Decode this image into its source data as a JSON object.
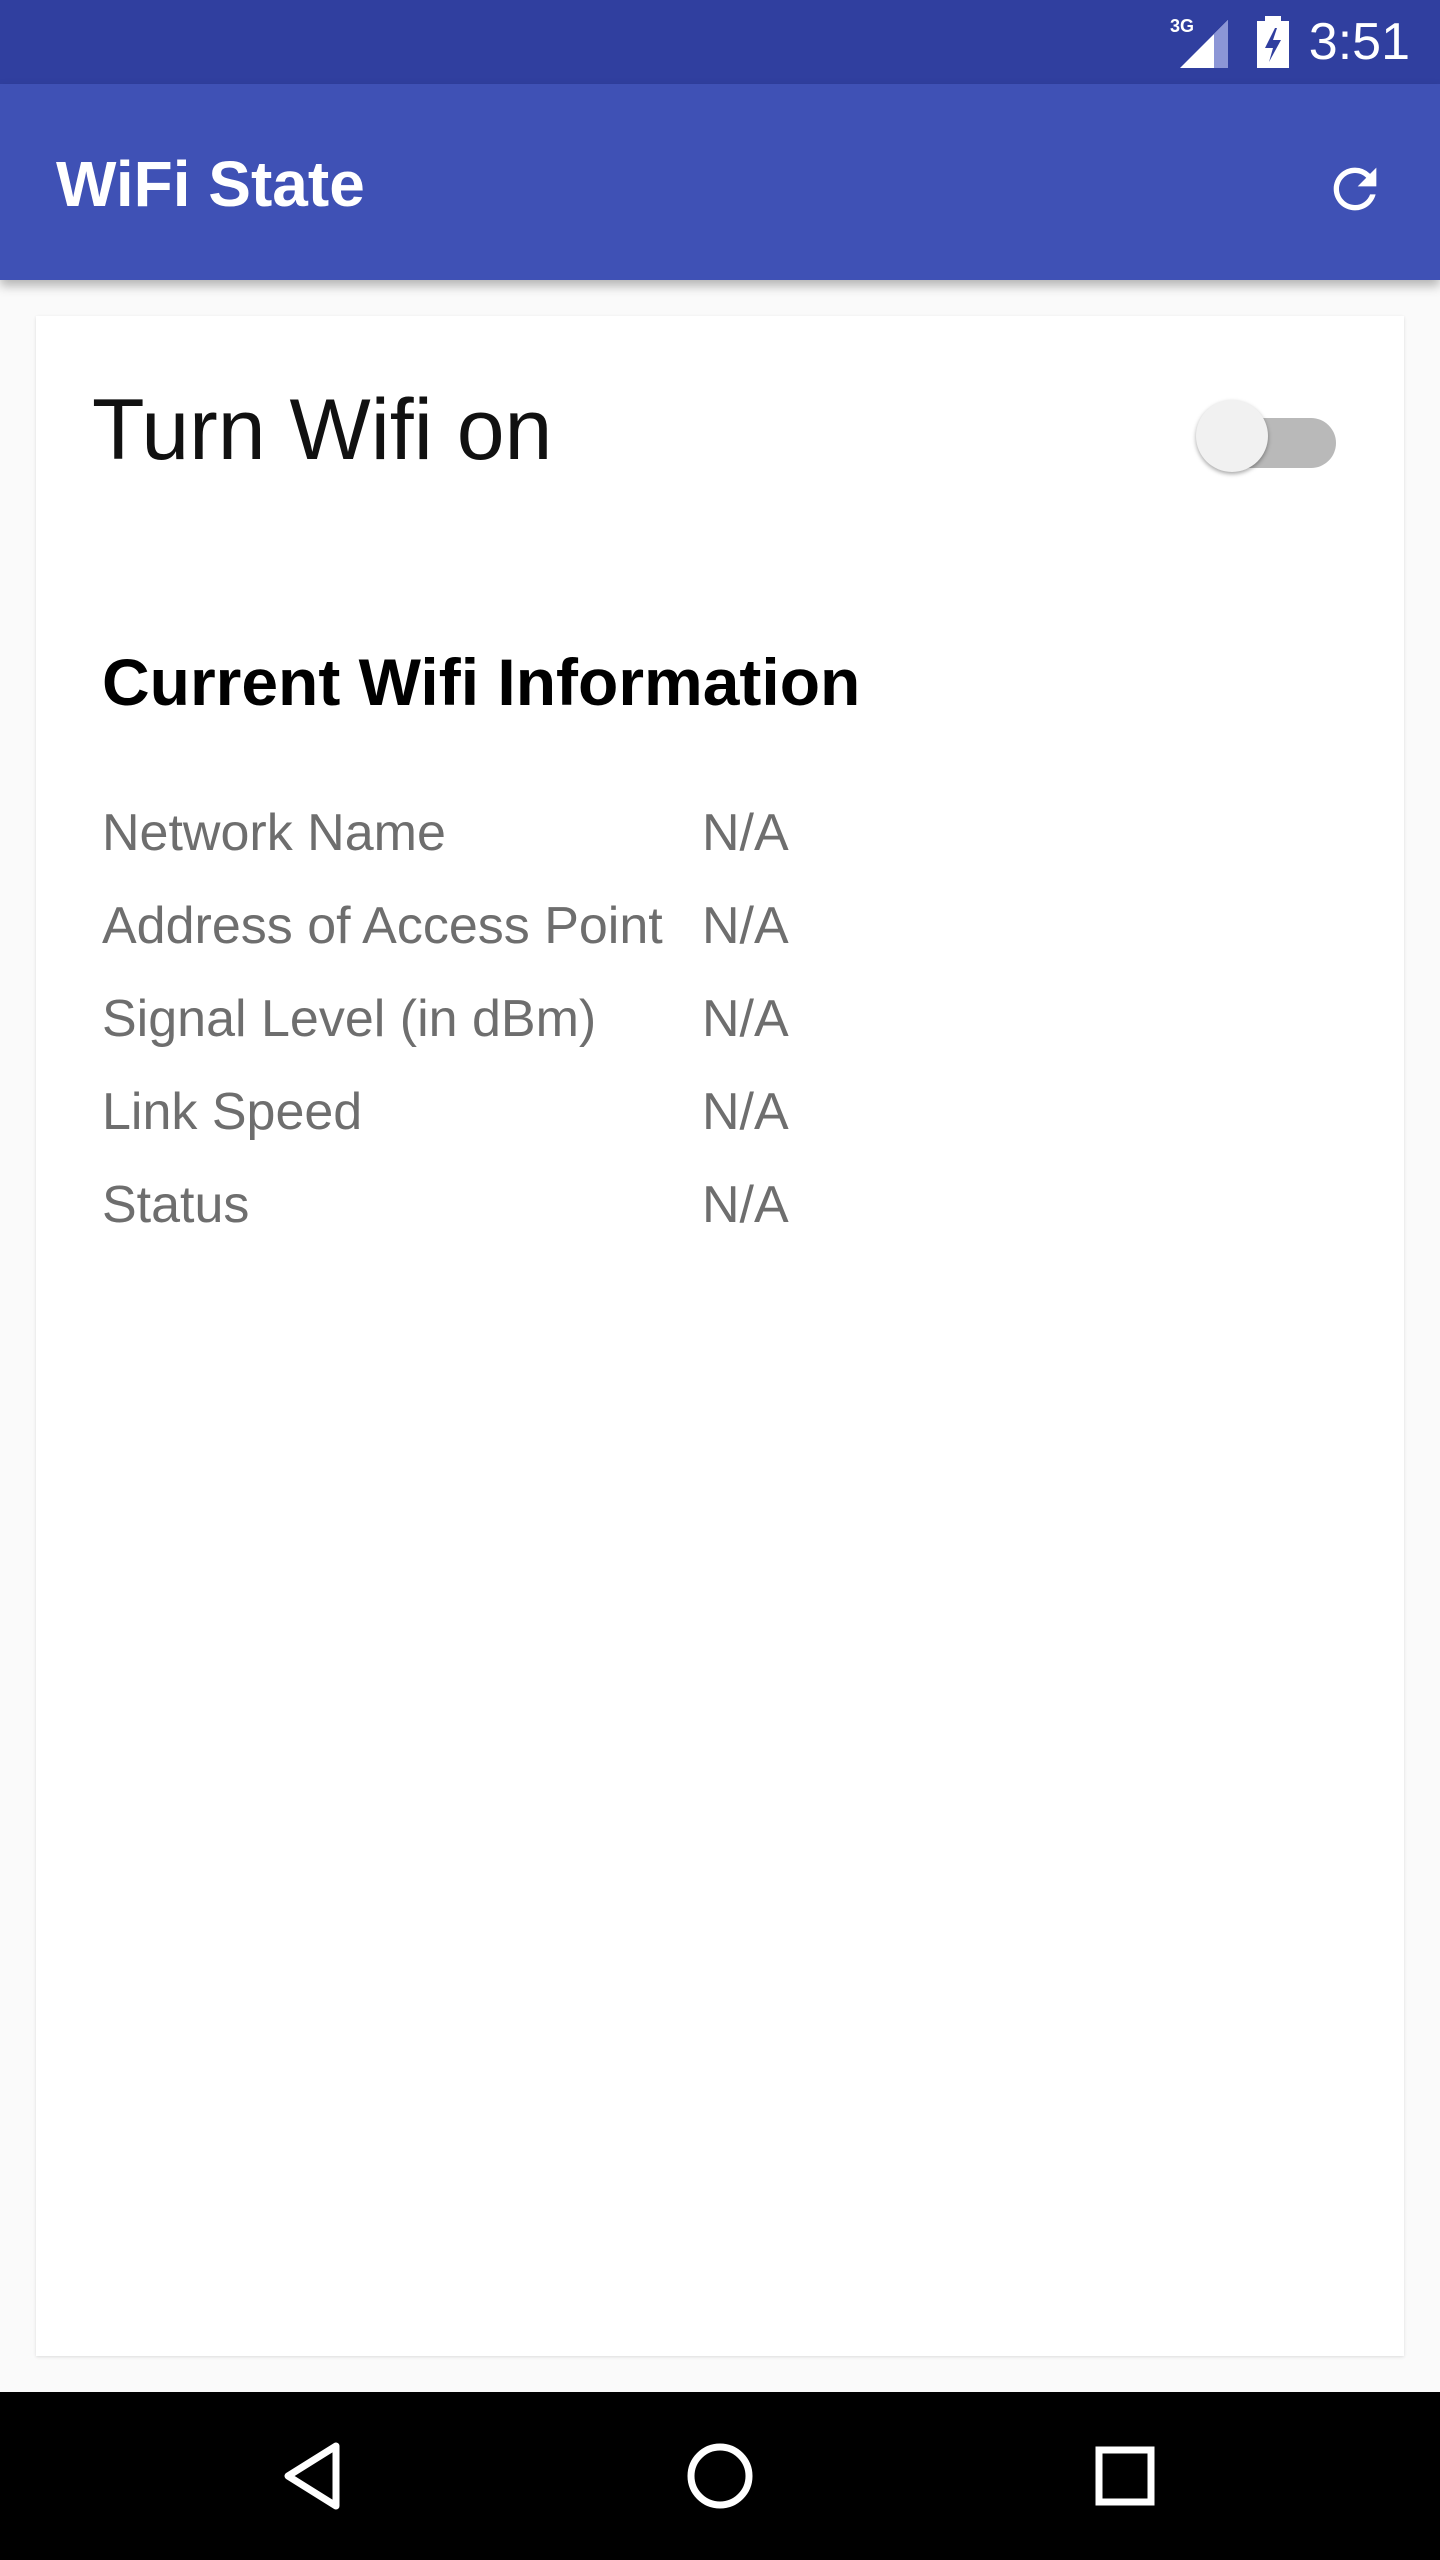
{
  "status_bar": {
    "time": "3:51",
    "network_type": "3G",
    "signal_icon": "signal-icon",
    "battery_icon": "battery-charging-icon"
  },
  "app_bar": {
    "title": "WiFi State",
    "refresh_icon": "refresh-icon"
  },
  "toggle": {
    "label": "Turn Wifi on",
    "checked": false
  },
  "info": {
    "title": "Current Wifi Information",
    "rows": [
      {
        "label": "Network Name",
        "value": "N/A"
      },
      {
        "label": "Address of Access Point",
        "value": "N/A"
      },
      {
        "label": "Signal Level (in dBm)",
        "value": "N/A"
      },
      {
        "label": "Link Speed",
        "value": "N/A"
      },
      {
        "label": "Status",
        "value": "N/A"
      }
    ]
  },
  "nav_bar": {
    "back_icon": "back-icon",
    "home_icon": "home-icon",
    "recents_icon": "recents-icon"
  },
  "colors": {
    "primary": "#3f51b5",
    "primary_dark": "#303f9f"
  }
}
